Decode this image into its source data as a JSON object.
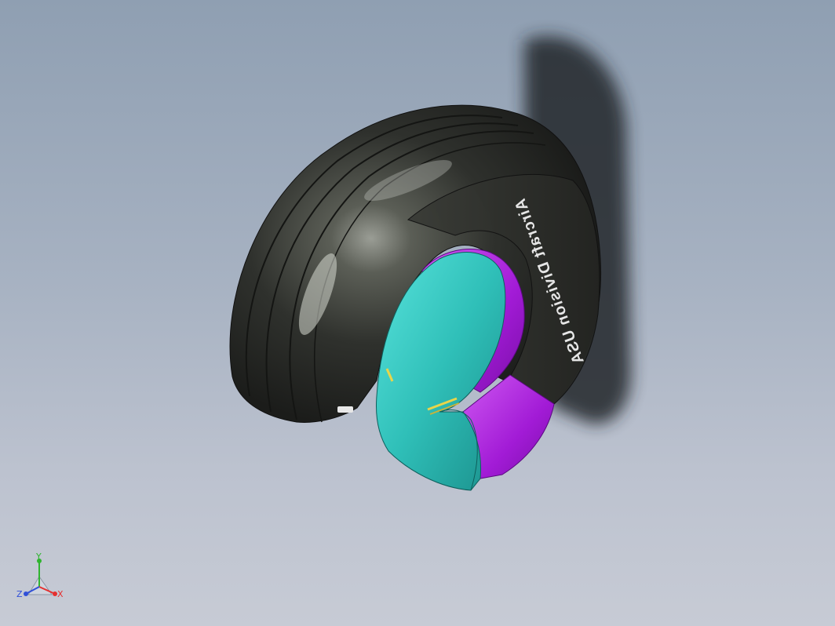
{
  "viewport": {
    "background_top": "#8f9fb2",
    "background_bottom": "#c7cbd5"
  },
  "model": {
    "sidewall_text": "Aircraft Division USA",
    "colors": {
      "tire": "#2c2e2b",
      "tube": "#2fc7c0",
      "rim": "#a21bd6",
      "cord": "#e8d54a",
      "shadow": "#2a2d33"
    }
  },
  "triad": {
    "x_label": "X",
    "y_label": "Y",
    "z_label": "Z",
    "x_color": "#e53030",
    "y_color": "#2fb52f",
    "z_color": "#3050d8"
  }
}
